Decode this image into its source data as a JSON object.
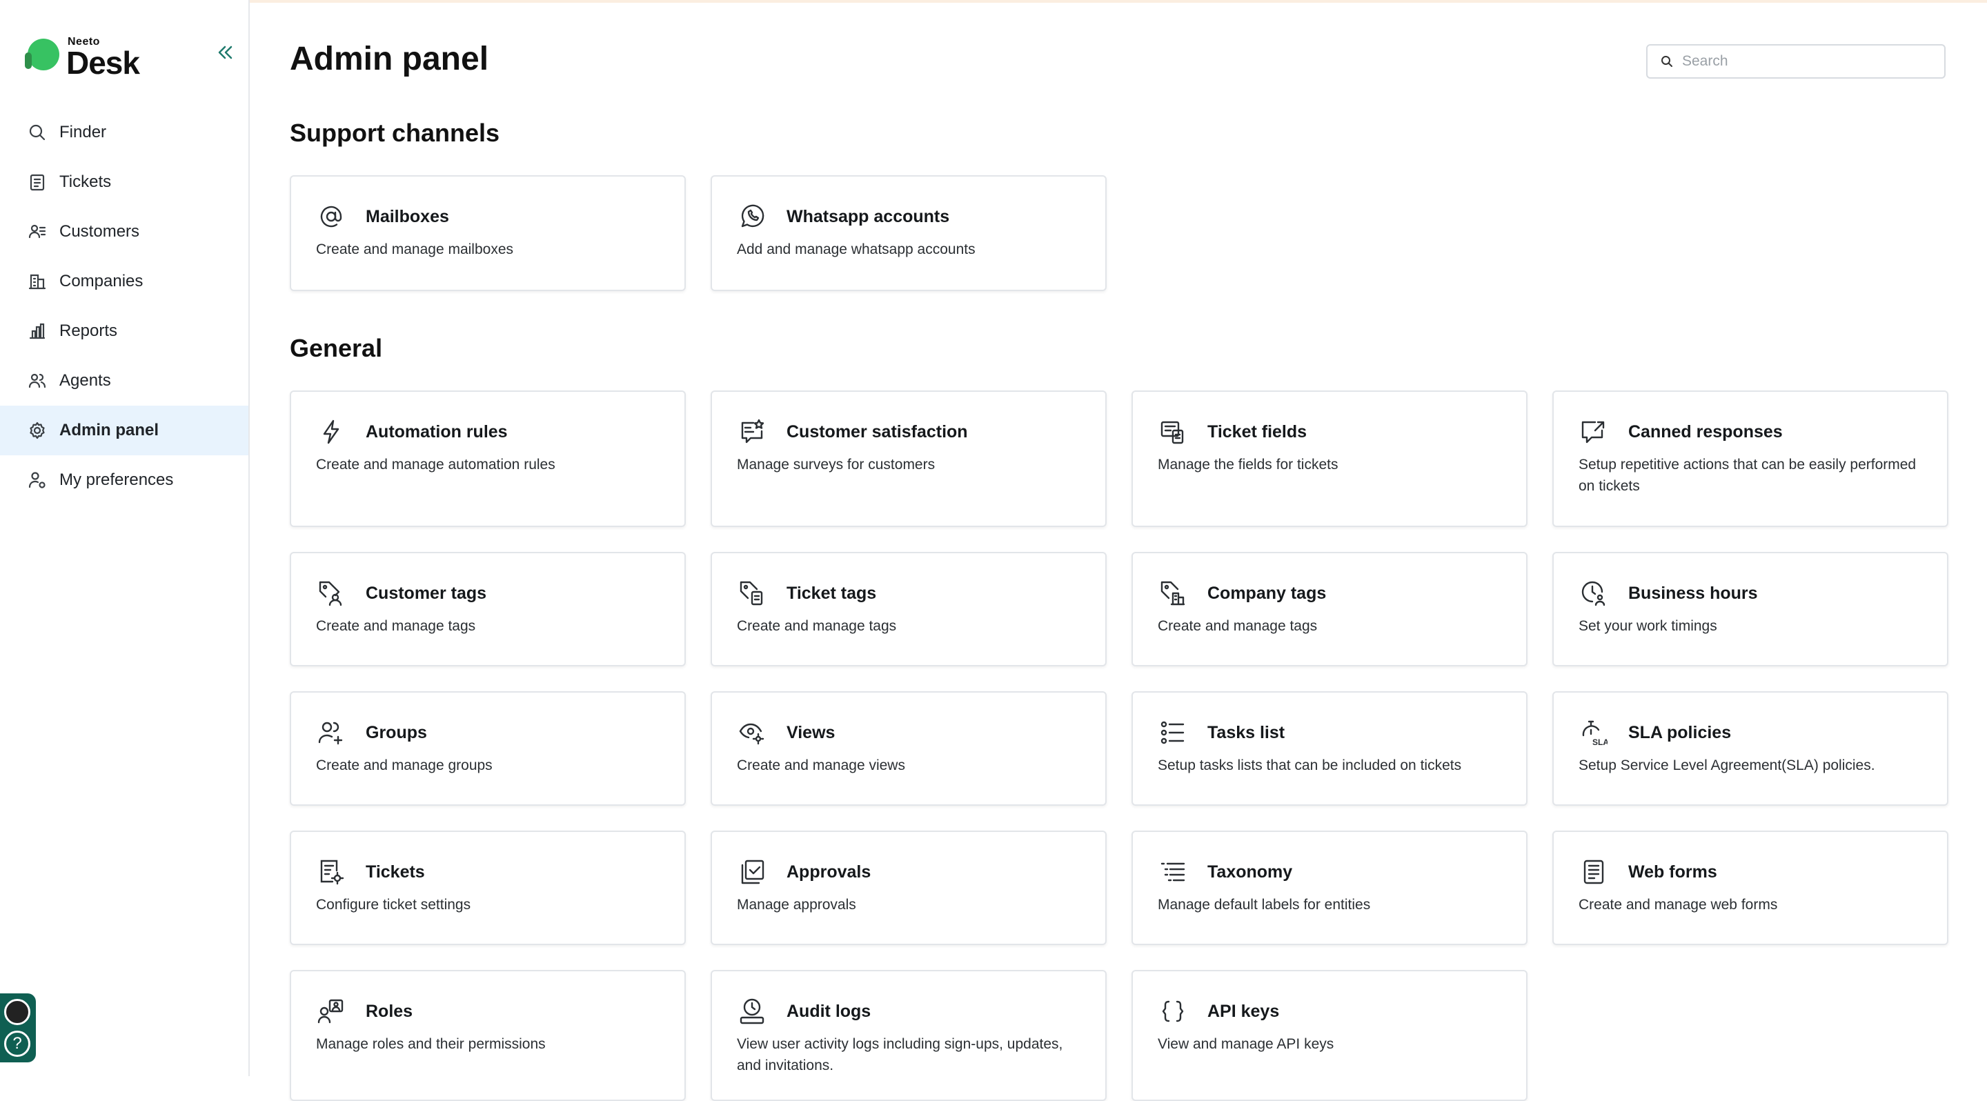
{
  "app": {
    "logo_small": "Neeto",
    "logo_big": "Desk"
  },
  "sidebar": {
    "items": [
      {
        "label": "Finder",
        "icon": "search-icon"
      },
      {
        "label": "Tickets",
        "icon": "tickets-icon"
      },
      {
        "label": "Customers",
        "icon": "customers-icon"
      },
      {
        "label": "Companies",
        "icon": "companies-icon"
      },
      {
        "label": "Reports",
        "icon": "reports-icon"
      },
      {
        "label": "Agents",
        "icon": "agents-icon"
      },
      {
        "label": "Admin panel",
        "icon": "gear-icon",
        "active": true
      },
      {
        "label": "My preferences",
        "icon": "user-settings-icon"
      }
    ]
  },
  "header": {
    "title": "Admin panel",
    "search_placeholder": "Search"
  },
  "sections": {
    "support": {
      "title": "Support channels",
      "cards": [
        {
          "title": "Mailboxes",
          "desc": "Create and manage mailboxes",
          "icon": "at-sign-icon"
        },
        {
          "title": "Whatsapp accounts",
          "desc": "Add and manage whatsapp accounts",
          "icon": "whatsapp-icon"
        }
      ]
    },
    "general": {
      "title": "General",
      "cards": [
        {
          "title": "Automation rules",
          "desc": "Create and manage automation rules",
          "icon": "lightning-icon"
        },
        {
          "title": "Customer satisfaction",
          "desc": "Manage surveys for customers",
          "icon": "survey-star-icon"
        },
        {
          "title": "Ticket fields",
          "desc": "Manage the fields for tickets",
          "icon": "ticket-fields-icon"
        },
        {
          "title": "Canned responses",
          "desc": "Setup repetitive actions that can be easily performed on tickets",
          "icon": "canned-response-icon"
        },
        {
          "title": "Customer tags",
          "desc": "Create and manage tags",
          "icon": "customer-tag-icon"
        },
        {
          "title": "Ticket tags",
          "desc": "Create and manage tags",
          "icon": "ticket-tag-icon"
        },
        {
          "title": "Company tags",
          "desc": "Create and manage tags",
          "icon": "company-tag-icon"
        },
        {
          "title": "Business hours",
          "desc": "Set your work timings",
          "icon": "clock-user-icon"
        },
        {
          "title": "Groups",
          "desc": "Create and manage groups",
          "icon": "group-add-icon"
        },
        {
          "title": "Views",
          "desc": "Create and manage views",
          "icon": "eye-gear-icon"
        },
        {
          "title": "Tasks list",
          "desc": "Setup tasks lists that can be included on tickets",
          "icon": "task-list-icon"
        },
        {
          "title": "SLA policies",
          "desc": "Setup Service Level Agreement(SLA) policies.",
          "icon": "sla-timer-icon"
        },
        {
          "title": "Tickets",
          "desc": "Configure ticket settings",
          "icon": "ticket-settings-icon"
        },
        {
          "title": "Approvals",
          "desc": "Manage approvals",
          "icon": "approval-check-icon"
        },
        {
          "title": "Taxonomy",
          "desc": "Manage default labels for entities",
          "icon": "taxonomy-icon"
        },
        {
          "title": "Web forms",
          "desc": "Create and manage web forms",
          "icon": "web-form-icon"
        },
        {
          "title": "Roles",
          "desc": "Manage roles and their permissions",
          "icon": "roles-icon"
        },
        {
          "title": "Audit logs",
          "desc": "View user activity logs including sign-ups, updates, and invitations.",
          "icon": "audit-log-icon"
        },
        {
          "title": "API keys",
          "desc": "View and manage API keys",
          "icon": "curly-braces-icon"
        }
      ]
    }
  },
  "colors": {
    "accent": "#1f7a6d",
    "active_bg": "#e8f3fd",
    "logo_green": "#37c262"
  }
}
